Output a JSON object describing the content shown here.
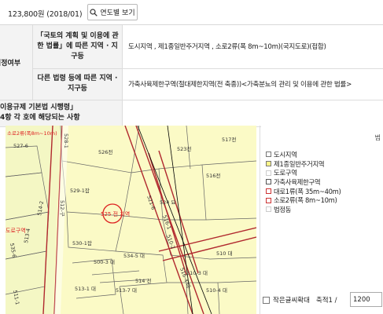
{
  "price": {
    "text": "123,800원 (2018/01)"
  },
  "year_button": {
    "label": "연도별 보기"
  },
  "rows": [
    {
      "left": "",
      "head": "「국토의 계획 및 이용에 관한 법률」에 따른 지역 · 지구등",
      "value": "도시지역 , 제1종일반주거지역 , 소로2류(폭 8m~10m)(국지도로)(접합)"
    },
    {
      "left": "",
      "head": "다른 법령 등에 따른 지역 · 지구등",
      "value": "가축사육제한구역(절대제한지역(전 축종))<가축분뇨의 관리 및 이용에 관한 법률>"
    }
  ],
  "left_label": "지정여부",
  "row3": {
    "head_lines": [
      "이용규제 기본법 시행령」",
      "4항 각 호에 해당되는 사항"
    ],
    "value": ""
  },
  "legend": {
    "corner": "범",
    "items": [
      {
        "label": "도시지역",
        "color": "#ffffff",
        "border": "#777777"
      },
      {
        "label": "제1종일반주거지역",
        "color": "#fdf48a",
        "border": "#777777"
      },
      {
        "label": "도로구역",
        "color": "#ffffff",
        "border": "#cccccc"
      },
      {
        "label": "가축사육제한구역",
        "color": "#ffffff",
        "border": "#555555"
      },
      {
        "label": "대로1류(폭 35m~40m)",
        "color": "#ffffff",
        "border": "#cc3333"
      },
      {
        "label": "소로2류(폭 8m~10m)",
        "color": "#ffffff",
        "border": "#cc3333"
      },
      {
        "label": "법정동",
        "color": "#ffffff",
        "border": "#cccccc"
      }
    ],
    "zoom_label": "작은글씨확대",
    "scale_label": "축적1 /",
    "scale_value": "1200"
  },
  "map": {
    "highlight": "525 전 지역",
    "labels": [
      "526전",
      "523전",
      "527-6",
      "528-1",
      "529-1잡",
      "524 묘",
      "516전",
      "512-구",
      "514-2",
      "513-4",
      "530-1잡",
      "510 대",
      "514 전",
      "513-1 대",
      "513-7 대",
      "511-1",
      "516-4 대",
      "510-4 대",
      "521-6",
      "516-1",
      "529-12",
      "517전",
      "535-6",
      "530-2",
      "530-3",
      "500-3 대",
      "534-5 대",
      "534-4 대",
      "510-2",
      "510-1",
      "510-3 대",
      "도로구역",
      "소로2류(폭8m~10m)"
    ]
  }
}
